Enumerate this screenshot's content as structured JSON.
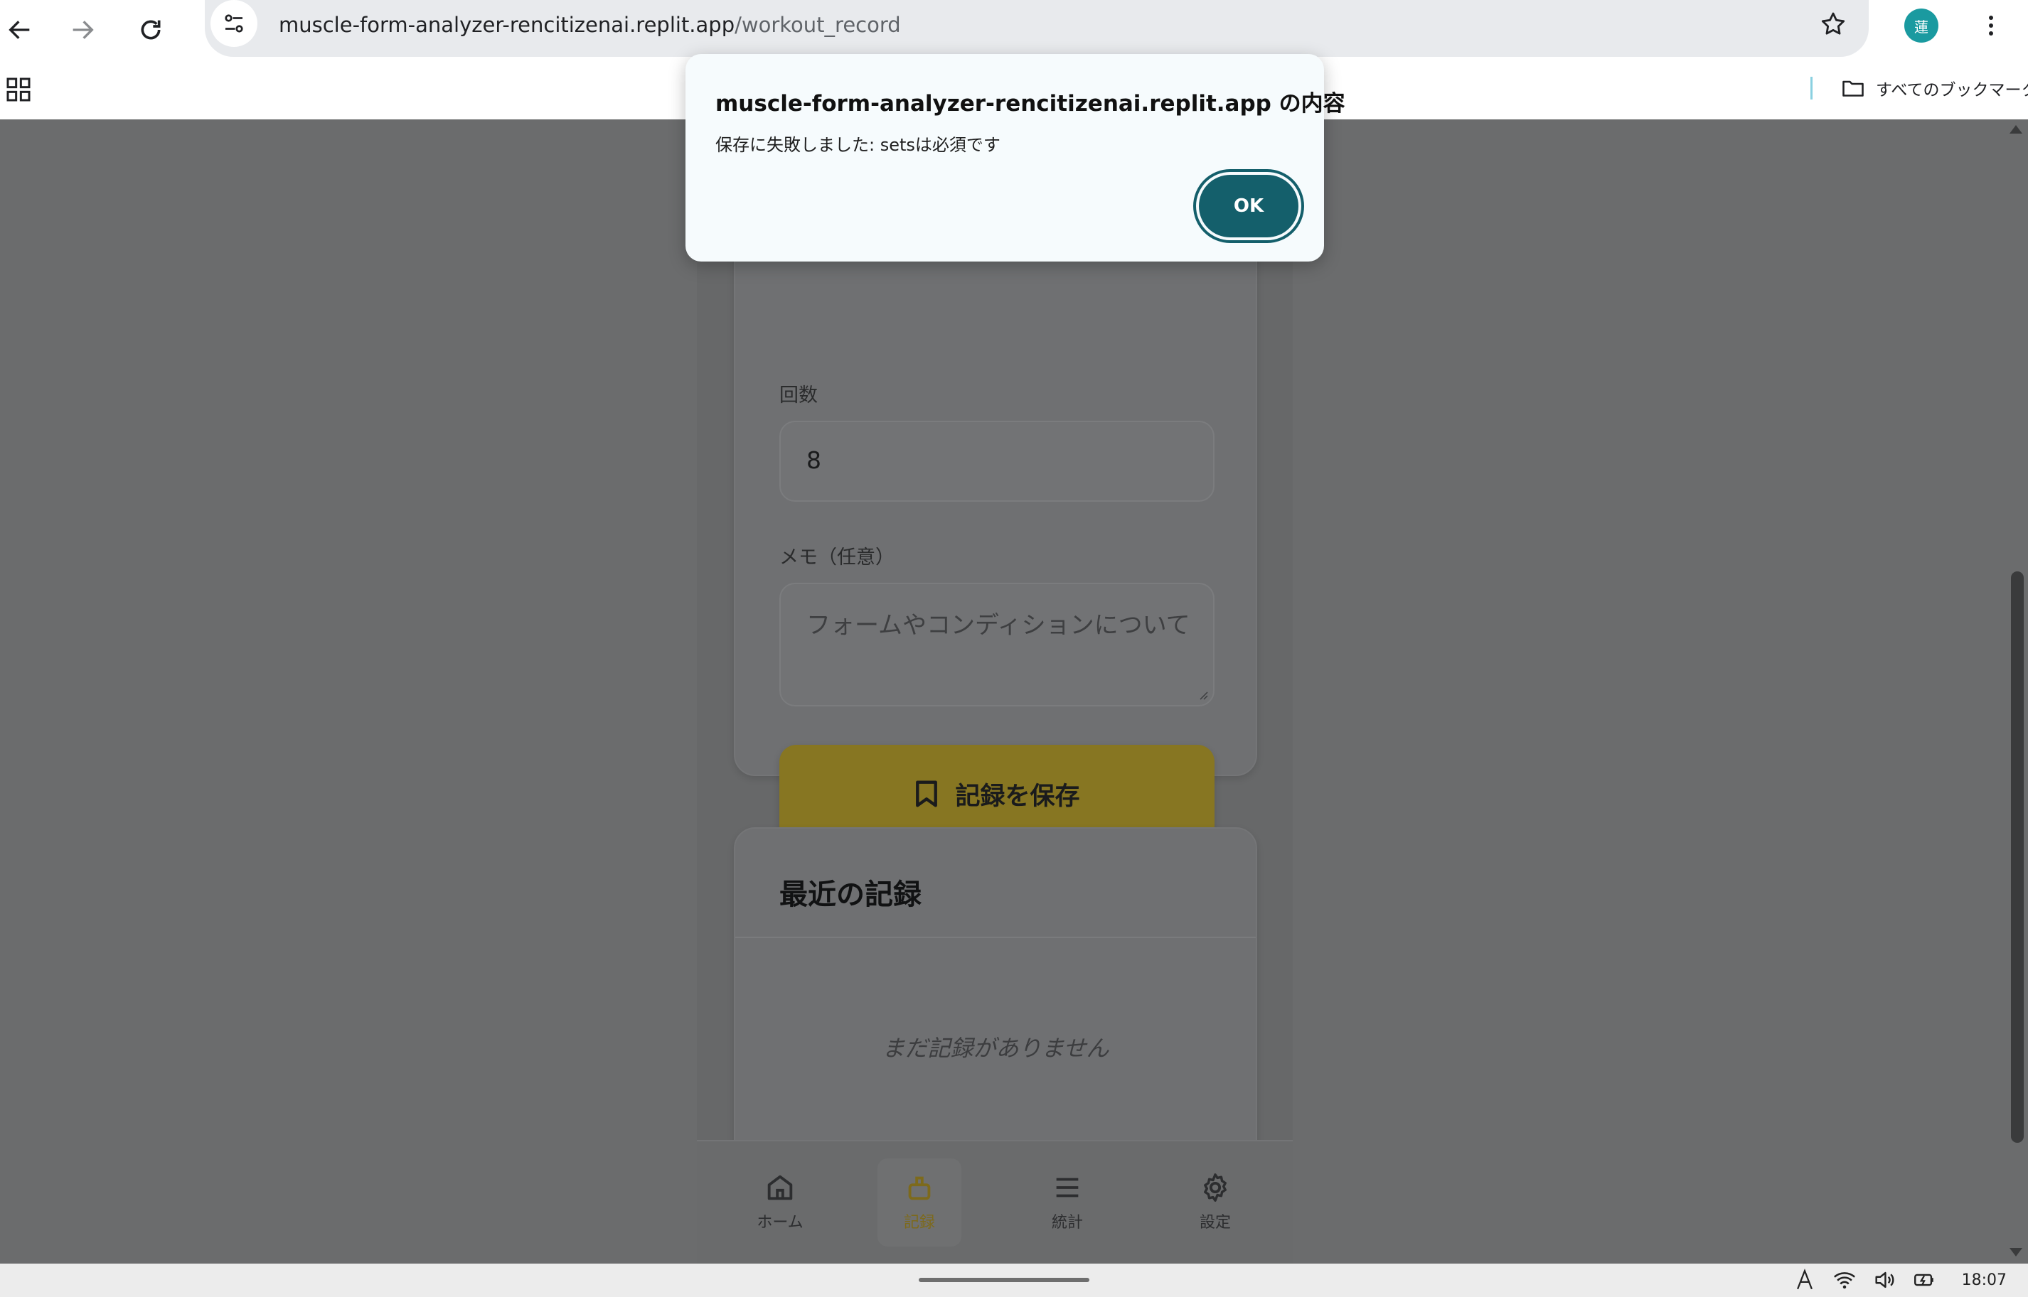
{
  "browser": {
    "url_host": "muscle-form-analyzer-rencitizenai.replit.app",
    "url_path": "/workout_record",
    "profile_initial": "蓮",
    "all_bookmarks_label": "すべてのブックマーク"
  },
  "form": {
    "reps_label": "回数",
    "reps_value": "8",
    "memo_label": "メモ（任意）",
    "memo_placeholder": "フォームやコンディションについて",
    "save_label": "記録を保存"
  },
  "recent": {
    "title": "最近の記録",
    "empty_text": "まだ記録がありません"
  },
  "bottom_nav": [
    {
      "label": "ホーム",
      "icon": "home-icon",
      "active": false
    },
    {
      "label": "記録",
      "icon": "dumbbell-icon",
      "active": true
    },
    {
      "label": "統計",
      "icon": "list-icon",
      "active": false
    },
    {
      "label": "設定",
      "icon": "gear-icon",
      "active": false
    }
  ],
  "dialog": {
    "title": "muscle-form-analyzer-rencitizenai.replit.app の内容",
    "message": "保存に失敗しました: setsは必須です",
    "ok_label": "OK"
  },
  "system": {
    "time": "18:07"
  },
  "colors": {
    "dialog_button": "#145f6b",
    "save_button_dimmed": "#877622",
    "active_nav": "#7d6a1c",
    "profile": "#1a9aa0"
  }
}
